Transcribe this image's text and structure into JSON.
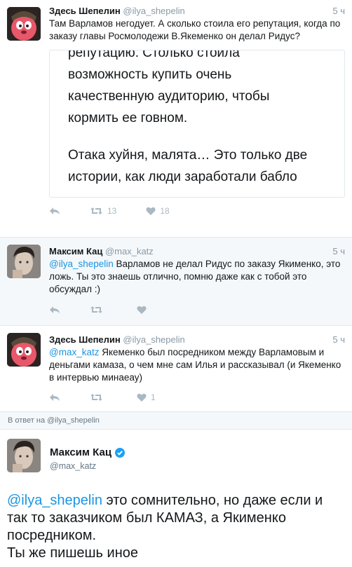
{
  "tweets": [
    {
      "name": "Здесь Шепелин",
      "handle": "@ilya_shepelin",
      "time": "5 ч",
      "text": "Там Варламов негодует. А сколько стоила его репутация, когда по заказу главы Росмолодежи В.Якеменко он делал Ридус?",
      "card_lines": [
        "репутацию. Столько стоила",
        "возможность купить очень",
        "качественную аудиторию, чтобы",
        "кормить ее говном.",
        "",
        "Отака хуйня, малята… Это только две",
        "истории, как люди заработали бабло"
      ],
      "retweets": "13",
      "likes": "18"
    },
    {
      "name": "Максим Кац",
      "handle": "@max_katz",
      "time": "5 ч",
      "mention": "@ilya_shepelin",
      "text": " Варламов не делал Ридус по заказу Якименко, это ложь. Ты это знаешь отлично, помню даже как с тобой это обсуждал :)",
      "retweets": "",
      "likes": ""
    },
    {
      "name": "Здесь Шепелин",
      "handle": "@ilya_shepelin",
      "time": "5 ч",
      "mention": "@max_katz",
      "text": " Якеменко был посредником между Варламовым и деньгами камаза, о чем мне сам Илья и рассказывал (и Якеменко в интервью минаеау)",
      "retweets": "",
      "likes": "1"
    }
  ],
  "reply_context": "В ответ на @ilya_shepelin",
  "main_tweet": {
    "name": "Максим Кац",
    "handle": "@max_katz",
    "mention": "@ilya_shepelin",
    "text_part1": " это сомнительно, но даже если и так то заказчиком был КАМАЗ, а Якименко посредником.",
    "text_part2": "Ты же пишешь иное"
  },
  "icons": {
    "reply": "reply-icon",
    "retweet": "retweet-icon",
    "like": "heart-icon",
    "verified": "verified-badge-icon"
  },
  "colors": {
    "link": "#1b95e0",
    "muted": "#8899a6",
    "verified": "#1da1f2"
  }
}
